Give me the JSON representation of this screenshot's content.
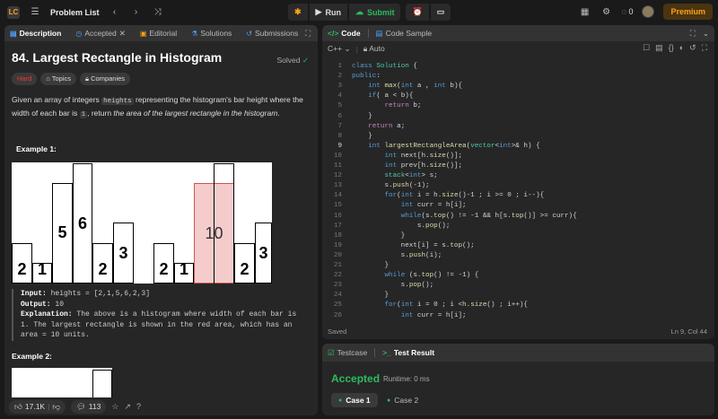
{
  "topbar": {
    "logo": "LC",
    "problem_list": "Problem List",
    "run": "Run",
    "submit": "Submit",
    "count": "0",
    "premium": "Premium"
  },
  "left_tabs": [
    "Description",
    "Accepted",
    "Editorial",
    "Solutions",
    "Submissions"
  ],
  "problem": {
    "title": "84. Largest Rectangle in Histogram",
    "solved": "Solved",
    "difficulty": "Hard",
    "topics": "Topics",
    "companies": "Companies",
    "desc_1": "Given an array of integers ",
    "desc_code1": "heights",
    "desc_2": " representing the histogram's bar height where the width of each bar is ",
    "desc_code2": "1",
    "desc_3": ", return ",
    "desc_em": "the area of the largest rectangle in the histogram",
    "desc_4": ".",
    "example1": "Example 1:",
    "example2": "Example 2:",
    "hist_values": [
      "2",
      "1",
      "5",
      "6",
      "2",
      "3",
      "2",
      "1",
      "2",
      "3"
    ],
    "highlight_label": "10",
    "input_label": "Input:",
    "input_value": " heights = [2,1,5,6,2,3]",
    "output_label": "Output:",
    "output_value": " 10",
    "explanation_label": "Explanation:",
    "explanation_value": " The above is a histogram where width of each bar is 1. The largest rectangle is shown in the red area, which has an area = 10 units."
  },
  "footer": {
    "likes": "17.1K",
    "comments": "113"
  },
  "code_tabs": [
    "Code",
    "Code Sample"
  ],
  "code_bar": {
    "language": "C++",
    "mode": "Auto"
  },
  "code_lines": [
    "class Solution {",
    "public:",
    "    int max(int a , int b){",
    "    if( a < b){",
    "        return b;",
    "    }",
    "    return a;",
    "    }",
    "    int largestRectangleArea(vector<int>& h) {",
    "        int next[h.size()];",
    "        int prev[h.size()];",
    "        stack<int> s;",
    "        s.push(-1);",
    "        for(int i = h.size()-1 ; i >= 0 ; i--){",
    "            int curr = h[i];",
    "            while(s.top() != -1 && h[s.top()] >= curr){",
    "                s.pop();",
    "            }",
    "            next[i] = s.top();",
    "            s.push(i);",
    "        }",
    "        while (s.top() != -1) {",
    "            s.pop();",
    "        }",
    "        for(int i = 0 ; i <h.size() ; i++){",
    "            int curr = h[i];"
  ],
  "editor_status": {
    "saved": "Saved",
    "position": "Ln 9, Col 44"
  },
  "result_tabs": [
    "Testcase",
    "Test Result"
  ],
  "result": {
    "status": "Accepted",
    "runtime": "Runtime: 0 ms",
    "cases": [
      "Case 1",
      "Case 2"
    ]
  }
}
